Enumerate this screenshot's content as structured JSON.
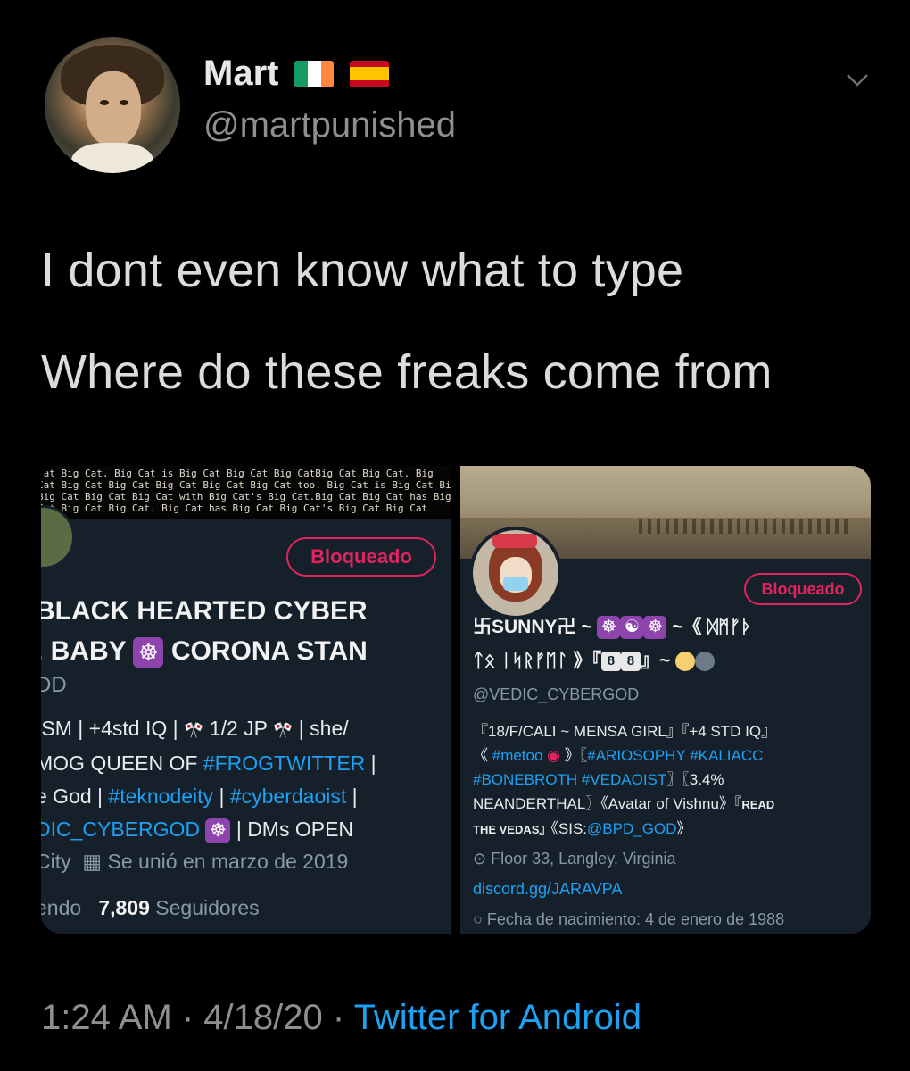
{
  "author": {
    "name": "Mart",
    "handle": "@martpunished",
    "flags": [
      "ireland-flag",
      "spain-flag"
    ]
  },
  "tweet": {
    "line1": "I dont even know what to type",
    "line2": "Where do these freaks come from"
  },
  "left_card": {
    "banner_lines": [
      "…at Big Cat. Big Cat is Big Cat Big Cat Big CatBig Cat Big Cat. Big",
      "Cat Big Cat Big Cat Big Cat Big Cat Big Cat too. Big Cat is Big Cat Big",
      "Big Cat Big Cat Big Cat with Big Cat's Big Cat.Big Cat Big Cat has Big",
      "Cat Big Cat Big Cat. Big Cat has Big Cat Big Cat's Big Cat Big Cat"
    ],
    "blocked_label": "Bloqueado",
    "name_line1": "BLACK HEARTED CYBER",
    "name_line2_pre": ". BABY",
    "name_line2_post": "CORONA STAN",
    "handle": "DD",
    "bio_line1_pre": "ISM | +4std IQ |",
    "bio_line1_mid": "1/2 JP",
    "bio_line1_post": "| she/",
    "bio_line2_pre": "MOG QUEEN OF",
    "bio_line2_link": "#FROGTWITTER",
    "bio_line2_post": "|",
    "bio_line3_pre": "e God |",
    "bio_line3_link1": "#teknodeity",
    "bio_line3_sep": "|",
    "bio_line3_link2": "#cyberdaoist",
    "bio_line3_post": "|",
    "bio_line4_link": "DIC_CYBERGOD",
    "bio_line4_post": "| DMs OPEN",
    "location": "City",
    "joined": "Se unió en marzo de 2019",
    "following_label": "endo",
    "followers_count": "7,809",
    "followers_label": "Seguidores"
  },
  "right_card": {
    "blocked_label": "Bloqueado",
    "name_line1_pre": "卐SUNNY卍 ~",
    "name_line1_post": "~《 ᛞᛗᚠᚦ",
    "name_line2_pre": "ᛏᛟ ᛁᛋᚱᚠᛖᛚ 》『",
    "name_line2_num1": "8",
    "name_line2_num2": "8",
    "name_line2_post": "』~",
    "handle": "@VEDIC_CYBERGOD",
    "bio_line1": "『18/F/CALI ~ MENSA GIRL』『+4 STD IQ』",
    "bio_line2_pre": "《",
    "bio_line2_link1": "#metoo",
    "bio_line2_mid": "》〖",
    "bio_line2_link2": "#ARIOSOPHY #KALIACC",
    "bio_line3_link": "#BONEBROTH #VEDAOIST",
    "bio_line3_post": "〗〖3.4%",
    "bio_line4": "NEANDERTHAL〗《Avatar of Vishnu》『",
    "bio_line4_caps": "READ",
    "bio_line5_caps": "THE VEDAS』",
    "bio_line5_pre": "《SIS:",
    "bio_line5_link": "@BPD_GOD",
    "bio_line5_post": "》",
    "location": "Floor 33, Langley, Virginia",
    "url": "discord.gg/JARAVPA",
    "birthday": "Fecha de nacimiento: 4 de enero de 1988"
  },
  "footer": {
    "time": "1:24 AM · 4/18/20 ·",
    "source": "Twitter for Android"
  },
  "colors": {
    "background": "#000000",
    "panel": "#15202b",
    "accent_blue": "#1da1f2",
    "blocked_red": "#e0245e",
    "muted": "#8899a6"
  }
}
